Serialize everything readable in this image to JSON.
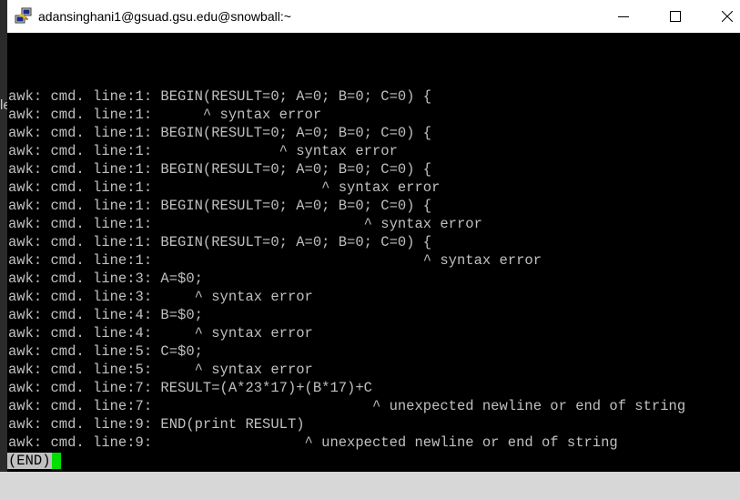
{
  "window": {
    "title": "adansinghani1@gsuad.gsu.edu@snowball:~",
    "app_icon": "putty-icon",
    "minimize_icon": "minimize-icon",
    "maximize_icon": "maximize-icon",
    "close_icon": "close-icon"
  },
  "background_window": {
    "partial_text": "le"
  },
  "terminal": {
    "lines": [
      "awk: cmd. line:1: BEGIN(RESULT=0; A=0; B=0; C=0) {",
      "awk: cmd. line:1:      ^ syntax error",
      "awk: cmd. line:1: BEGIN(RESULT=0; A=0; B=0; C=0) {",
      "awk: cmd. line:1:               ^ syntax error",
      "awk: cmd. line:1: BEGIN(RESULT=0; A=0; B=0; C=0) {",
      "awk: cmd. line:1:                    ^ syntax error",
      "awk: cmd. line:1: BEGIN(RESULT=0; A=0; B=0; C=0) {",
      "awk: cmd. line:1:                         ^ syntax error",
      "awk: cmd. line:1: BEGIN(RESULT=0; A=0; B=0; C=0) {",
      "awk: cmd. line:1:                                ^ syntax error",
      "awk: cmd. line:3: A=$0;",
      "awk: cmd. line:3:     ^ syntax error",
      "awk: cmd. line:4: B=$0;",
      "awk: cmd. line:4:     ^ syntax error",
      "awk: cmd. line:5: C=$0;",
      "awk: cmd. line:5:     ^ syntax error",
      "awk: cmd. line:7: RESULT=(A*23*17)+(B*17)+C",
      "awk: cmd. line:7:                          ^ unexpected newline or end of string",
      "awk: cmd. line:9: END(print RESULT)",
      "awk: cmd. line:9:                  ^ unexpected newline or end of string"
    ],
    "pager_status": "(END)",
    "colors": {
      "background": "#000000",
      "foreground": "#c0c0c0",
      "cursor": "#00e000",
      "status_bg": "#c0c0c0",
      "status_fg": "#000000"
    }
  }
}
